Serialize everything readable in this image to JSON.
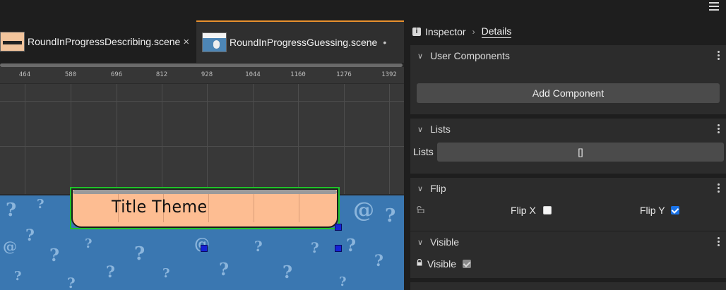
{
  "tabs": [
    {
      "label": "RoundInProgressDescribing.scene",
      "close": "×"
    },
    {
      "label": "RoundInProgressGuessing.scene",
      "modified": "•"
    }
  ],
  "ruler_ticks": [
    "464",
    "580",
    "696",
    "812",
    "928",
    "1044",
    "1160",
    "1276",
    "1392"
  ],
  "scene": {
    "title_text": "Title Theme"
  },
  "inspector": {
    "breadcrumb": [
      "Inspector",
      "Details"
    ],
    "sections": {
      "user_components": {
        "title": "User Components",
        "button": "Add Component"
      },
      "lists": {
        "title": "Lists",
        "label": "Lists",
        "value": "[]"
      },
      "flip": {
        "title": "Flip",
        "flip_x_label": "Flip X",
        "flip_x": false,
        "flip_y_label": "Flip Y",
        "flip_y": true
      },
      "visible": {
        "title": "Visible",
        "label": "Visible",
        "value": true
      }
    }
  },
  "colors": {
    "accent": "#1a73e8",
    "selection": "#1fc32a",
    "active_tab": "#e8912e"
  }
}
